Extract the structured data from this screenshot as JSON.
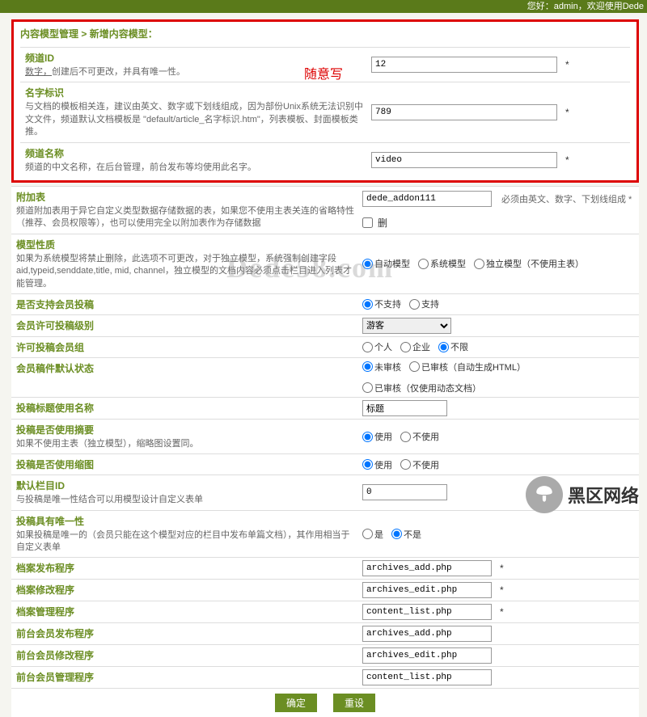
{
  "topbar": {
    "text": "您好：admin，欢迎使用Dede"
  },
  "breadcrumb": {
    "a": "内容模型管理",
    "sep": " > ",
    "b": "新增内容模型："
  },
  "randomtxt": "随意写",
  "rows": {
    "channelId": {
      "label": "频道ID",
      "desc_a": "数字，",
      "desc_b": "创建后不可更改，并具有唯一性。",
      "value": "12"
    },
    "nameId": {
      "label": "名字标识",
      "desc": "与文档的模板相关连，建议由英文、数字或下划线组成，因为部份Unix系统无法识别中文文件，频道默认文档模板是 \"default/article_名字标识.htm\"，列表模板、封面模板类推。",
      "value": "789"
    },
    "channelName": {
      "label": "频道名称",
      "desc": "频道的中文名称，在后台管理，前台发布等均使用此名字。",
      "value": "video"
    },
    "addonTable": {
      "label": "附加表",
      "desc": "频道附加表用于异它自定义类型数据存储数据的表，如果您不使用主表关连的省略特性（推荐、会员权限等），也可以使用完全以附加表作为存储数据",
      "value": "dede_addon111",
      "note": "必须由英文、数字、下划线组成 *",
      "cb": "删"
    },
    "modelType": {
      "label": "模型性质",
      "desc": "如果为系统模型将禁止删除，此选项不可更改，对于独立模型，系统强制创建字段aid,typeid,senddate,title, mid, channel，独立模型的文档内容必须点击栏目进入列表才能管理。",
      "opts": [
        "自动模型",
        "系统模型",
        "独立模型（不使用主表）"
      ],
      "sel": 0
    },
    "allowMember": {
      "label": "是否支持会员投稿",
      "opts": [
        "不支持",
        "支持"
      ],
      "sel": 0
    },
    "memberLevel": {
      "label": "会员许可投稿级别",
      "value": "游客"
    },
    "allowGroup": {
      "label": "许可投稿会员组",
      "opts": [
        "个人",
        "企业",
        "不限"
      ],
      "sel": 2
    },
    "defaultStatus": {
      "label": "会员稿件默认状态",
      "opts": [
        "未审核",
        "已审核（自动生成HTML）",
        "已审核（仅使用动态文档）"
      ],
      "sel": 0
    },
    "titleName": {
      "label": "投稿标题使用名称",
      "value": "标题"
    },
    "useDesc": {
      "label": "投稿是否使用摘要",
      "desc": "如果不使用主表（独立模型），缩略图设置同。",
      "opts": [
        "使用",
        "不使用"
      ],
      "sel": 0
    },
    "useThumb": {
      "label": "投稿是否使用缩图",
      "opts": [
        "使用",
        "不使用"
      ],
      "sel": 0
    },
    "defaultCat": {
      "label": "默认栏目ID",
      "desc": "与投稿是唯一性结合可以用模型设计自定义表单",
      "value": "0"
    },
    "unique": {
      "label": "投稿具有唯一性",
      "desc": "如果投稿是唯一的（会员只能在这个模型对应的栏目中发布单篇文档），其作用相当于自定义表单",
      "opts": [
        "是",
        "不是"
      ],
      "sel": 1
    },
    "addTpl": {
      "label": "档案发布程序",
      "value": "archives_add.php"
    },
    "editTpl": {
      "label": "档案修改程序",
      "value": "archives_edit.php"
    },
    "listTpl": {
      "label": "档案管理程序",
      "value": "content_list.php"
    },
    "memAdd": {
      "label": "前台会员发布程序",
      "value": "archives_add.php"
    },
    "memEdit": {
      "label": "前台会员修改程序",
      "value": "archives_edit.php"
    },
    "memList": {
      "label": "前台会员管理程序",
      "value": "content_list.php"
    }
  },
  "buttons": {
    "ok": "确定",
    "reset": "重设"
  },
  "watermark": "Dede58.com",
  "logo": "黑区网络"
}
